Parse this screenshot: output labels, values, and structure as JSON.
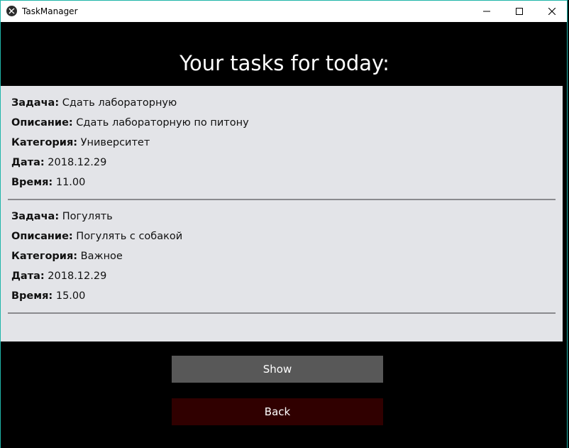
{
  "window": {
    "title": "TaskManager"
  },
  "heading": "Your tasks for today:",
  "tasks": [
    {
      "fields": [
        {
          "label": "Задача:",
          "value": " Сдать лабораторную"
        },
        {
          "label": "Описание:",
          "value": " Сдать лабораторную по питону"
        },
        {
          "label": "Категория:",
          "value": " Университет"
        },
        {
          "label": "Дата:",
          "value": " 2018.12.29"
        },
        {
          "label": "Время:",
          "value": " 11.00"
        }
      ]
    },
    {
      "fields": [
        {
          "label": "Задача:",
          "value": " Погулять"
        },
        {
          "label": "Описание:",
          "value": " Погулять с собакой"
        },
        {
          "label": "Категория:",
          "value": " Важное"
        },
        {
          "label": "Дата:",
          "value": " 2018.12.29"
        },
        {
          "label": "Время:",
          "value": " 15.00"
        }
      ]
    }
  ],
  "buttons": {
    "show_label": "Show",
    "back_label": "Back"
  },
  "colors": {
    "show_bg": "#585858",
    "back_bg": "#300000",
    "panel_bg": "#e3e4e8"
  },
  "icons": {
    "app": "kivy-app-icon",
    "minimize": "minimize-icon",
    "maximize": "maximize-icon",
    "close": "close-icon"
  }
}
